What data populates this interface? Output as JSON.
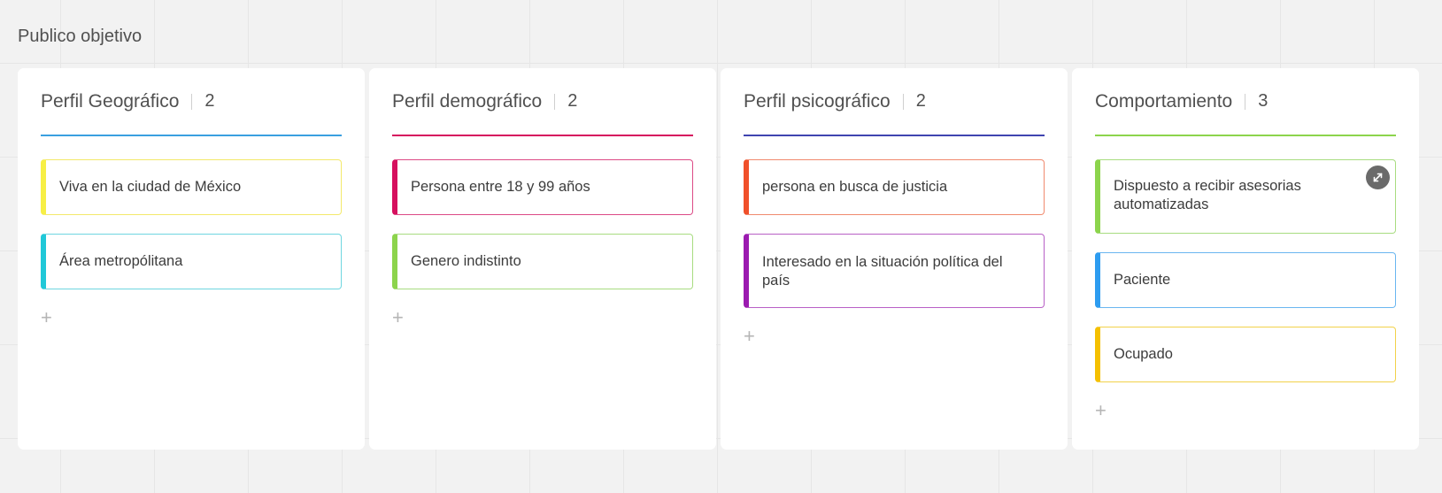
{
  "board": {
    "title": "Publico objetivo"
  },
  "columns": [
    {
      "title": "Perfil Geográfico",
      "count": "2",
      "color": "#3aa0e0",
      "cards": [
        {
          "text": "Viva en la ciudad de México",
          "color": "#f7ef45"
        },
        {
          "text": "Área metropólitana",
          "color": "#20c8d8"
        }
      ]
    },
    {
      "title": "Perfil demográfico",
      "count": "2",
      "color": "#d6105e",
      "cards": [
        {
          "text": "Persona entre 18 y 99 años",
          "color": "#d6105e"
        },
        {
          "text": "Genero indistinto",
          "color": "#8cd44c"
        }
      ]
    },
    {
      "title": "Perfil psicográfico",
      "count": "2",
      "color": "#3f44b0",
      "cards": [
        {
          "text": "persona en busca de justicia",
          "color": "#f0502a"
        },
        {
          "text": "Interesado en la situación política del país",
          "color": "#9b1bb0"
        }
      ]
    },
    {
      "title": "Comportamiento",
      "count": "3",
      "color": "#8cd44c",
      "cards": [
        {
          "text": "Dispuesto a recibir asesorias automatizadas",
          "color": "#8cd44c"
        },
        {
          "text": "Paciente",
          "color": "#2d9cf0"
        },
        {
          "text": "Ocupado",
          "color": "#f5c000"
        }
      ]
    }
  ],
  "icons": {
    "add": "+",
    "expand": "expand-icon"
  }
}
